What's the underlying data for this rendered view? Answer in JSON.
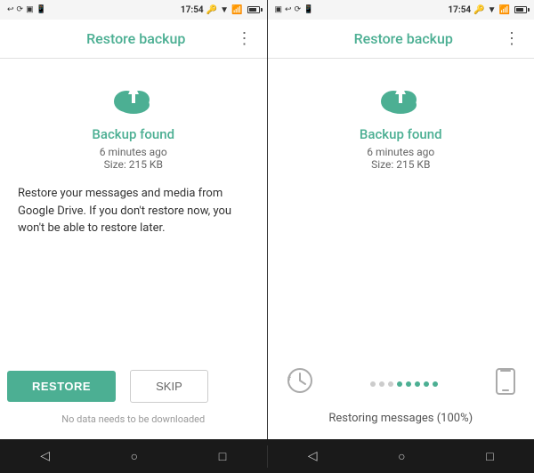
{
  "screens": [
    {
      "id": "screen1",
      "statusBar": {
        "leftIcons": [
          "↩",
          "⟳",
          "□",
          "📱"
        ],
        "time": "17:54",
        "rightIcons": [
          "🔑",
          "▼",
          "📶",
          "🔋"
        ]
      },
      "toolbar": {
        "title": "Restore backup",
        "menuIcon": "⋮"
      },
      "cloudIcon": "upload-cloud",
      "backupFound": "Backup found",
      "backupTime": "6 minutes ago",
      "backupSize": "Size: 215 KB",
      "description": "Restore your messages and media from Google Drive. If you don't restore now, you won't be able to restore later.",
      "restoreButton": "RESTORE",
      "skipButton": "SKIP",
      "noDownload": "No data needs to be downloaded"
    },
    {
      "id": "screen2",
      "statusBar": {
        "leftIcons": [
          "□",
          "↩",
          "⟳",
          "📱"
        ],
        "time": "17:54",
        "rightIcons": [
          "🔑",
          "▼",
          "📶",
          "🔋"
        ]
      },
      "toolbar": {
        "title": "Restore backup",
        "menuIcon": "⋮"
      },
      "cloudIcon": "upload-cloud",
      "backupFound": "Backup found",
      "backupTime": "6 minutes ago",
      "backupSize": "Size: 215 KB",
      "progressDots": [
        false,
        false,
        false,
        true,
        true,
        true,
        true,
        true
      ],
      "restoringText": "Restoring messages (100%)"
    }
  ],
  "navBar": {
    "backIcon": "◁",
    "homeIcon": "○",
    "recentIcon": "□"
  },
  "colors": {
    "teal": "#4CAF93",
    "lightGray": "#f5f5f5",
    "darkBg": "#1a1a1a"
  }
}
